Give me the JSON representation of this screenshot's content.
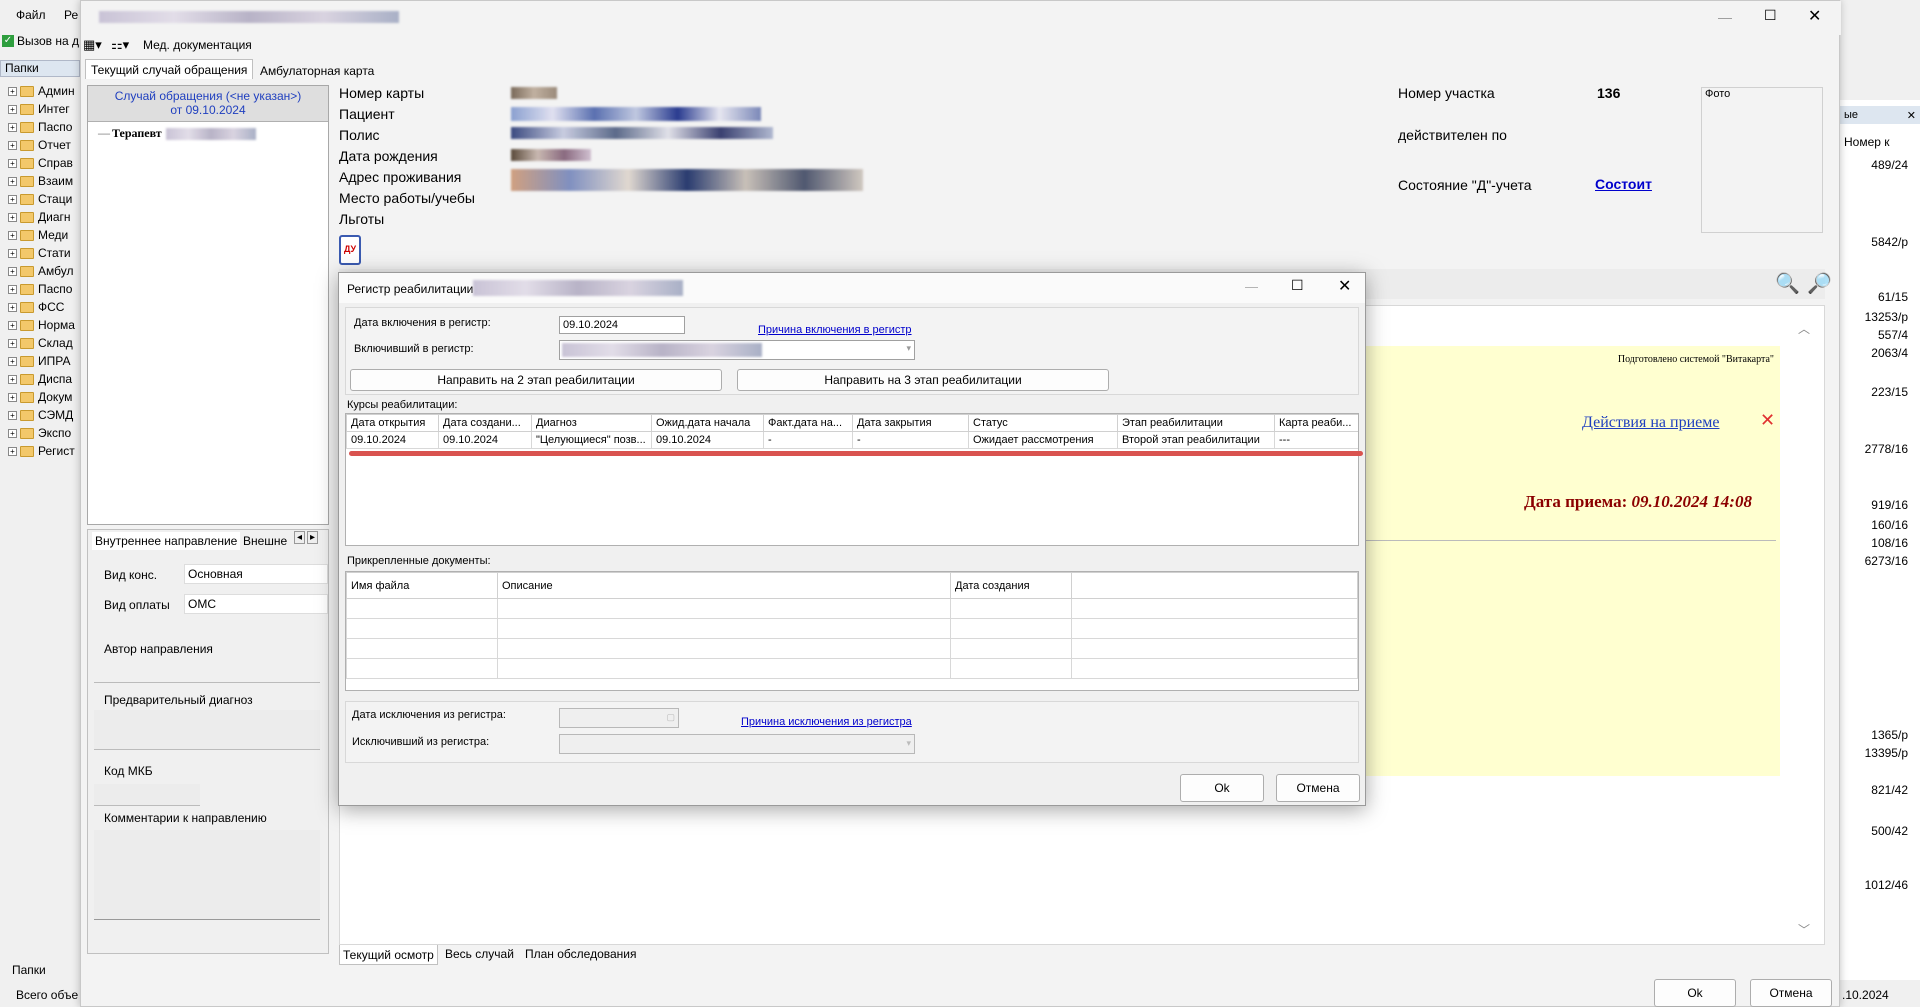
{
  "bg_app": {
    "menu": [
      "Файл",
      "Ре"
    ],
    "call_btn": "Вызов на д",
    "folders_tab": "Папки",
    "folders": [
      "Админ",
      "Интег",
      "Паспо",
      "Отчет",
      "Справ",
      "Взаим",
      "Стаци",
      "Диагн",
      "Меди",
      "Стати",
      "Амбул",
      "Паспо",
      "ФСС",
      "Норма",
      "Склад",
      "ИПРА",
      "Диспа",
      "Докум",
      "СЭМД",
      "Экспо",
      "Регист"
    ],
    "bottom_tab": "Папки",
    "status": "Всего объе",
    "right_header": "Номер к",
    "right_tab": "ые",
    "right_numbers": [
      "489/24",
      "5842/р",
      "61/15",
      "13253/р",
      "557/4",
      "2063/4",
      "223/15",
      "2778/16",
      "919/16",
      "160/16",
      "108/16",
      "6273/16",
      "1365/р",
      "13395/р",
      "821/42",
      "500/42",
      "1012/46"
    ],
    "right_date": ".10.2024"
  },
  "main": {
    "toolbar_med": "Мед. документация",
    "tabs": [
      "Текущий случай обращения",
      "Амбулаторная карта"
    ],
    "case_line1": "Случай обращения (<не указан>)",
    "case_line2": "от 09.10.2024",
    "tree_item": "Терапевт",
    "patient_labels": [
      "Номер карты",
      "Пациент",
      "Полис",
      "Дата рождения",
      "Адрес проживания",
      "Место работы/учебы",
      "Льготы"
    ],
    "district_label": "Номер участка",
    "district_value": "136",
    "valid_label": "действителен по",
    "d_state_label": "Состояние \"Д\"-учета",
    "d_state_link": "Состоит",
    "photo_label": "Фото",
    "du_icon_text": "ДУ",
    "dir_tabs": [
      "Внутреннее направление",
      "Внешне"
    ],
    "cons_label": "Вид конс.",
    "cons_value": "Основная",
    "pay_label": "Вид оплаты",
    "pay_value": "ОМС",
    "author_label": "Автор направления",
    "prediag_label": "Предварительный диагноз",
    "mkb_label": "Код МКБ",
    "comments_label": "Комментарии к направлению",
    "doc_prepared": "Подготовлено системой \"Витакарта\"",
    "doc_actions": "Действия на приеме",
    "doc_date_label": "Дата приема:",
    "doc_date_value": "09.10.2024 14:08",
    "bottom_tabs": [
      "Текущий осмотр",
      "Весь случай",
      "План обследования"
    ],
    "ok": "Ok",
    "cancel": "Отмена"
  },
  "dialog": {
    "title": "Регистр реабилитации",
    "incl_date_label": "Дата включения в регистр:",
    "incl_date_value": "09.10.2024",
    "incl_reason_link": "Причина включения в регистр",
    "included_by_label": "Включивший в регистр:",
    "btn_stage2": "Направить на 2 этап реабилитации",
    "btn_stage3": "Направить на 3 этап реабилитации",
    "courses_label": "Курсы реабилитации:",
    "courses_headers": [
      "Дата открытия",
      "Дата создани...",
      "Диагноз",
      "Ожид.дата начала",
      "Факт.дата  на...",
      "Дата закрытия",
      "Статус",
      "Этап реабилитации",
      "Карта  реаби..."
    ],
    "courses_rows": [
      [
        "09.10.2024",
        "09.10.2024",
        "\"Целующиеся\" позв...",
        "09.10.2024",
        "-",
        "-",
        "Ожидает рассмотрения",
        "Второй этап реабилитации",
        "---"
      ]
    ],
    "docs_label": "Прикрепленные документы:",
    "docs_headers": [
      "Имя файла",
      "Описание",
      "Дата создания"
    ],
    "excl_date_label": "Дата исключения из регистра:",
    "excl_reason_link": "Причина исключения из регистра",
    "excluded_by_label": "Исключивший из регистра:",
    "ok": "Ok",
    "cancel": "Отмена"
  },
  "colors": {
    "accent_red": "#d9534f",
    "link_blue": "#0000cc",
    "doc_yellow": "#ffffd0",
    "date_red": "#8b0000"
  }
}
